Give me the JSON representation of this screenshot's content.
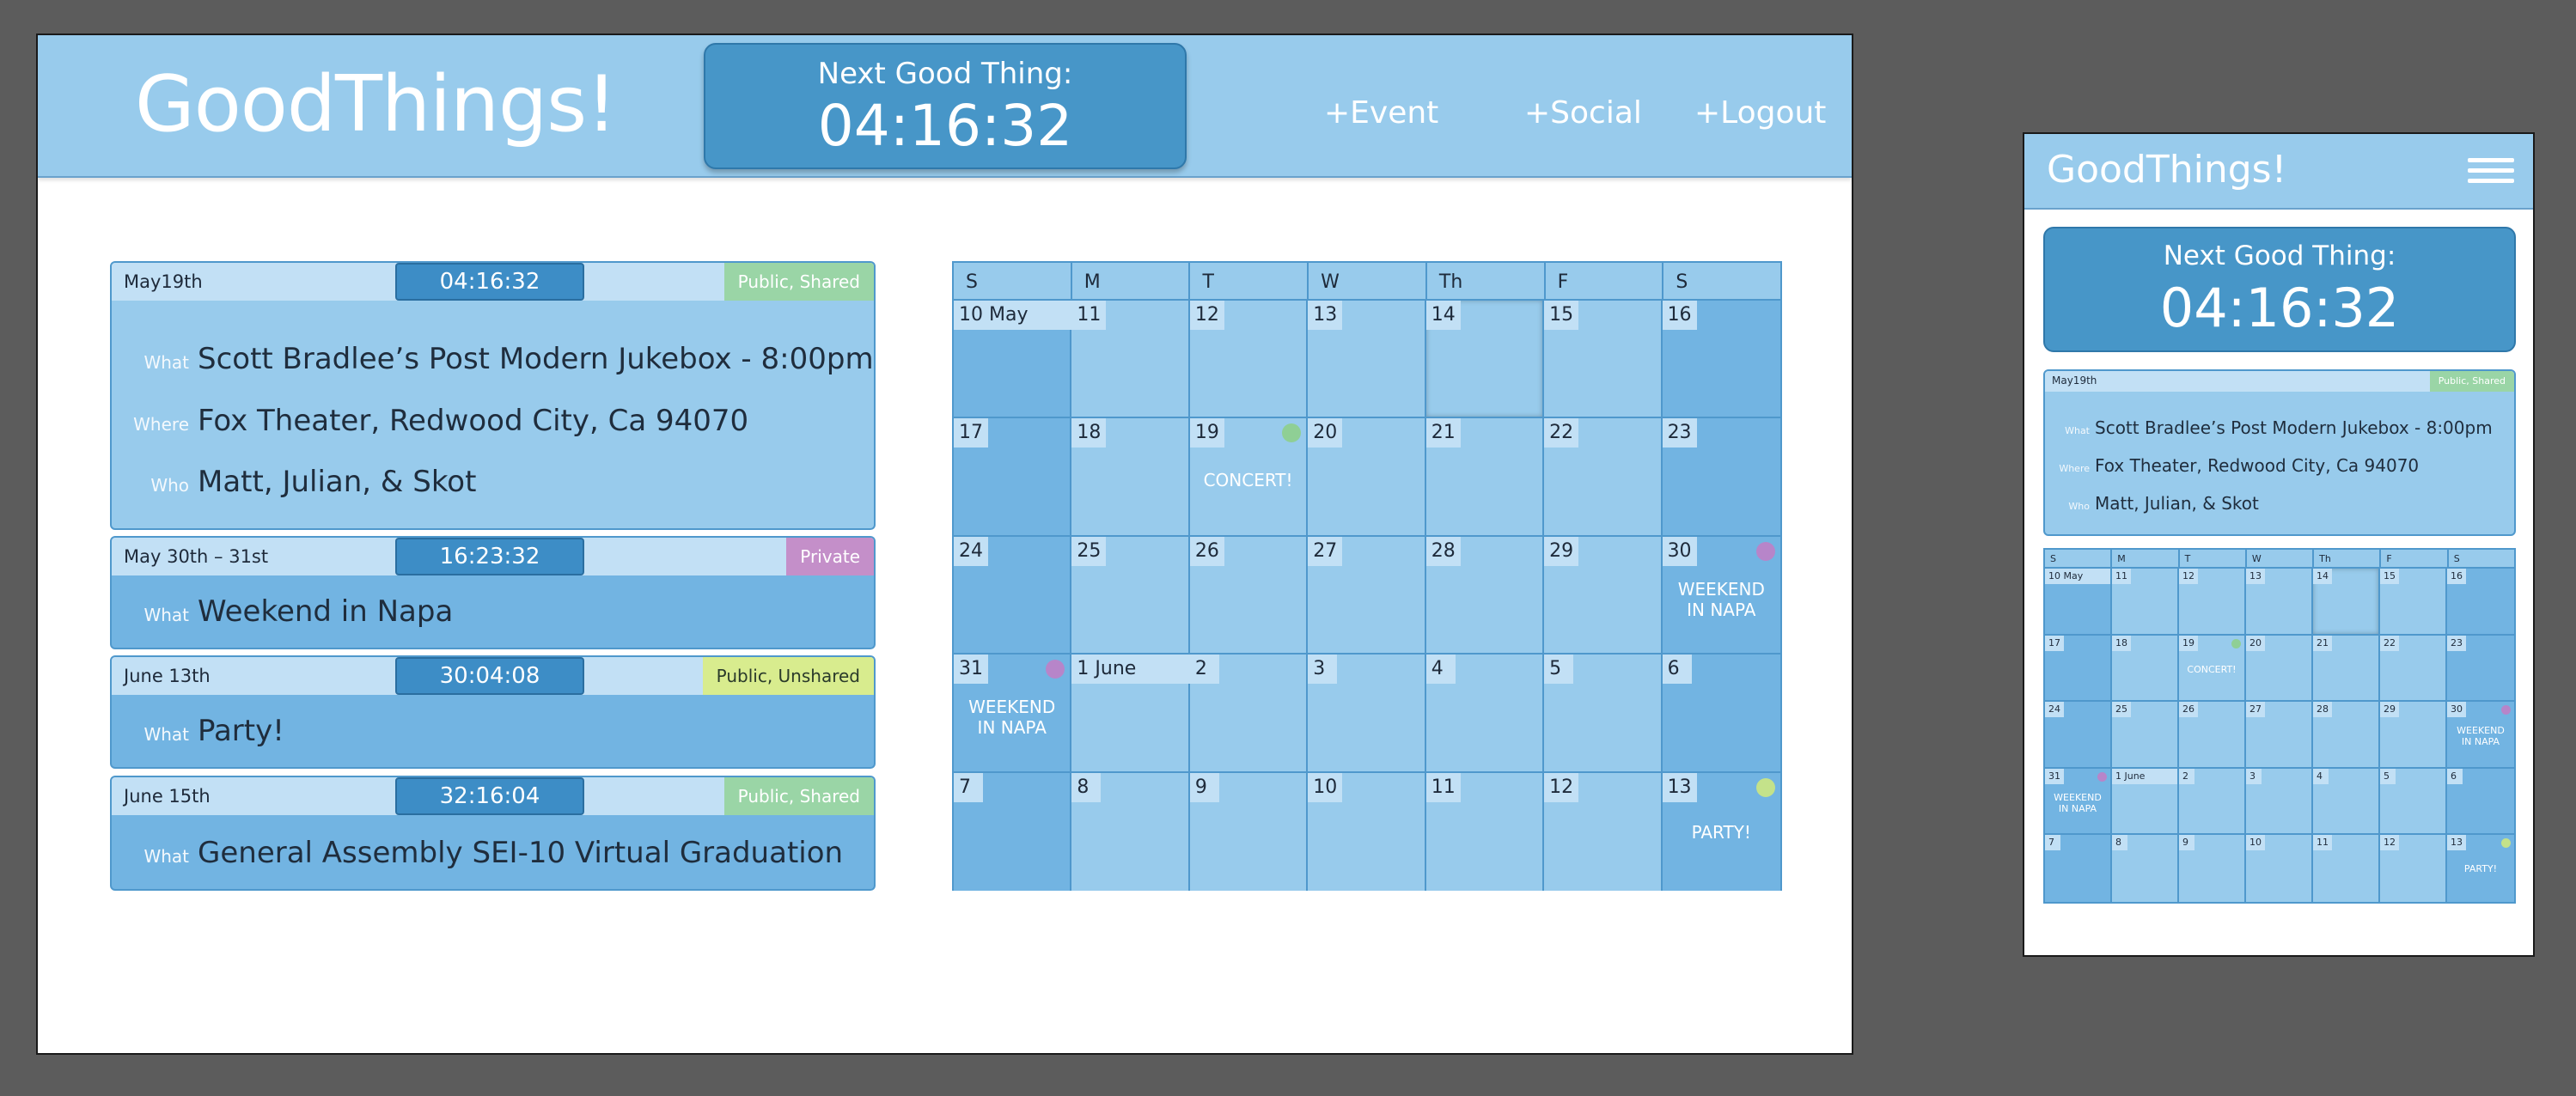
{
  "app": {
    "logo": "GoodThings!",
    "next_label": "Next Good Thing:",
    "next_time": "04:16:32",
    "nav": [
      "+Event",
      "+Social",
      "+Logout"
    ]
  },
  "field_labels": {
    "what": "What",
    "where": "Where",
    "who": "Who"
  },
  "events": [
    {
      "date": "May19th",
      "timer": "04:16:32",
      "badge": "Public, Shared",
      "badge_color": "#9ad5a6",
      "what": "Scott Bradlee’s Post Modern Jukebox  -  8:00pm",
      "where": "Fox Theater, Redwood City, Ca 94070",
      "who": "Matt, Julian, & Skot"
    },
    {
      "date": "May 30th – 31st",
      "timer": "16:23:32",
      "badge": "Private",
      "badge_color": "#c48fc9",
      "what": "Weekend in Napa"
    },
    {
      "date": "June 13th",
      "timer": "30:04:08",
      "badge": "Public, Unshared",
      "badge_color": "#d8ec8e",
      "what": "Party!"
    },
    {
      "date": "June 15th",
      "timer": "32:16:04",
      "badge": "Public, Shared",
      "badge_color": "#9ad5a6",
      "what": "General Assembly SEI-10 Virtual Graduation"
    }
  ],
  "calendar": {
    "weekdays": [
      "S",
      "M",
      "T",
      "W",
      "Th",
      "F",
      "S"
    ],
    "days": [
      "10  May",
      "11",
      "12",
      "13",
      "14",
      "15",
      "16",
      "17",
      "18",
      "19",
      "20",
      "21",
      "22",
      "23",
      "24",
      "25",
      "26",
      "27",
      "28",
      "29",
      "30",
      "31",
      "1   June",
      "2",
      "3",
      "4",
      "5",
      "6",
      "7",
      "8",
      "9",
      "10",
      "11",
      "12",
      "13"
    ],
    "event_labels": {
      "concert": "CONCERT!",
      "napa_1": "WEEKEND",
      "napa_2": "IN NAPA",
      "party": "PARTY!"
    }
  },
  "colors": {
    "header": "#98cbec",
    "accent": "#4796c8",
    "green": "#9ad5a6",
    "purple": "#c48fc9",
    "yellow": "#d8ec8e"
  },
  "icons": {
    "menu": "hamburger-menu-icon"
  }
}
